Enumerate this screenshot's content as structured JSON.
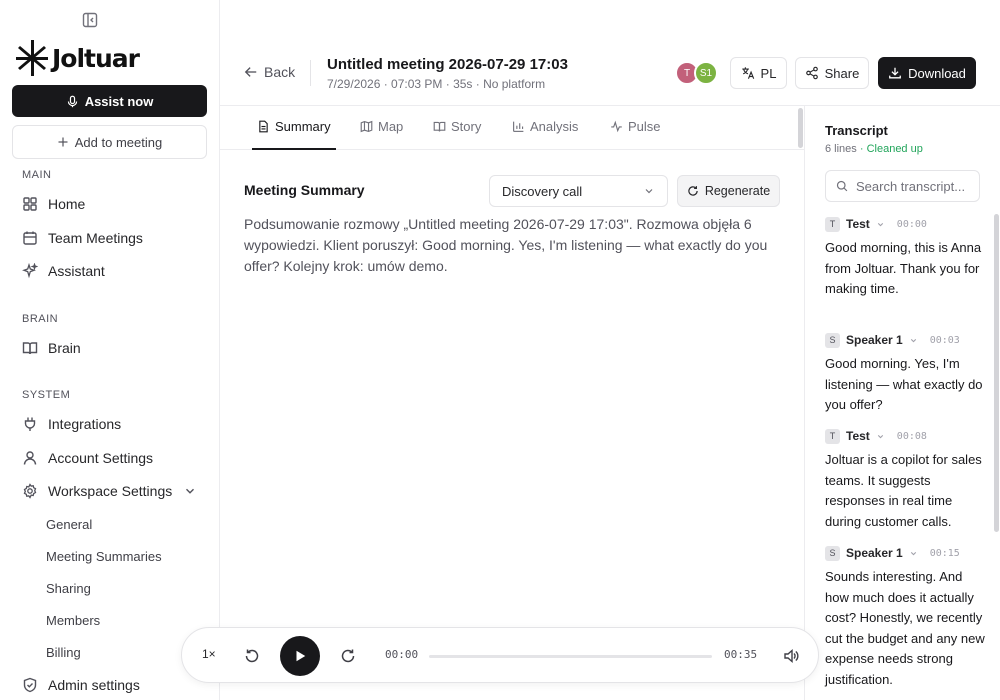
{
  "sidebar": {
    "logo_text": "Joltuar",
    "assist_label": "Assist now",
    "add_label": "Add to meeting",
    "main_label": "MAIN",
    "brain_label": "BRAIN",
    "system_label": "SYSTEM",
    "items": {
      "home": "Home",
      "team_meetings": "Team Meetings",
      "assistant": "Assistant",
      "brain": "Brain",
      "integrations": "Integrations",
      "account_settings": "Account Settings",
      "workspace_settings": "Workspace Settings",
      "admin_settings": "Admin settings"
    },
    "sub_items": {
      "general": "General",
      "meeting_summaries": "Meeting Summaries",
      "sharing": "Sharing",
      "members": "Members",
      "billing": "Billing"
    }
  },
  "header": {
    "back_label": "Back",
    "title": "Untitled meeting 2026-07-29 17:03",
    "subtitle": "7/29/2026 · 07:03 PM · 35s · No platform",
    "avatars": [
      {
        "initials": "T",
        "color": "#c2607a"
      },
      {
        "initials": "S1",
        "color": "#7cb342"
      }
    ],
    "lang_label": "PL",
    "share_label": "Share",
    "download_label": "Download"
  },
  "tabs": {
    "summary": "Summary",
    "map": "Map",
    "story": "Story",
    "analysis": "Analysis",
    "pulse": "Pulse"
  },
  "summary": {
    "heading": "Meeting Summary",
    "template_value": "Discovery call",
    "regenerate_label": "Regenerate",
    "text": "Podsumowanie rozmowy „Untitled meeting 2026-07-29 17:03\". Rozmowa objęła 6 wypowiedzi. Klient poruszył: Good morning. Yes, I'm listening — what exactly do you offer? Kolejny krok: umów demo."
  },
  "player": {
    "speed": "1×",
    "current_time": "00:00",
    "duration": "00:35",
    "progress": 0
  },
  "transcript": {
    "title": "Transcript",
    "count": "6 lines",
    "status": "· Cleaned up",
    "search_placeholder": "Search transcript...",
    "entries": [
      {
        "badge": "T",
        "speaker": "Test",
        "time": "00:00",
        "text": "Good morning, this is Anna from Joltuar. Thank you for making time."
      },
      {
        "badge": "S",
        "speaker": "Speaker 1",
        "time": "00:03",
        "text": "Good morning. Yes, I'm listening — what exactly do you offer?"
      },
      {
        "badge": "T",
        "speaker": "Test",
        "time": "00:08",
        "text": "Joltuar is a copilot for sales teams. It suggests responses in real time during customer calls."
      },
      {
        "badge": "S",
        "speaker": "Speaker 1",
        "time": "00:15",
        "text": "Sounds interesting. And how much does it actually cost? Honestly, we recently cut the budget and any new expense needs strong justification."
      }
    ]
  }
}
